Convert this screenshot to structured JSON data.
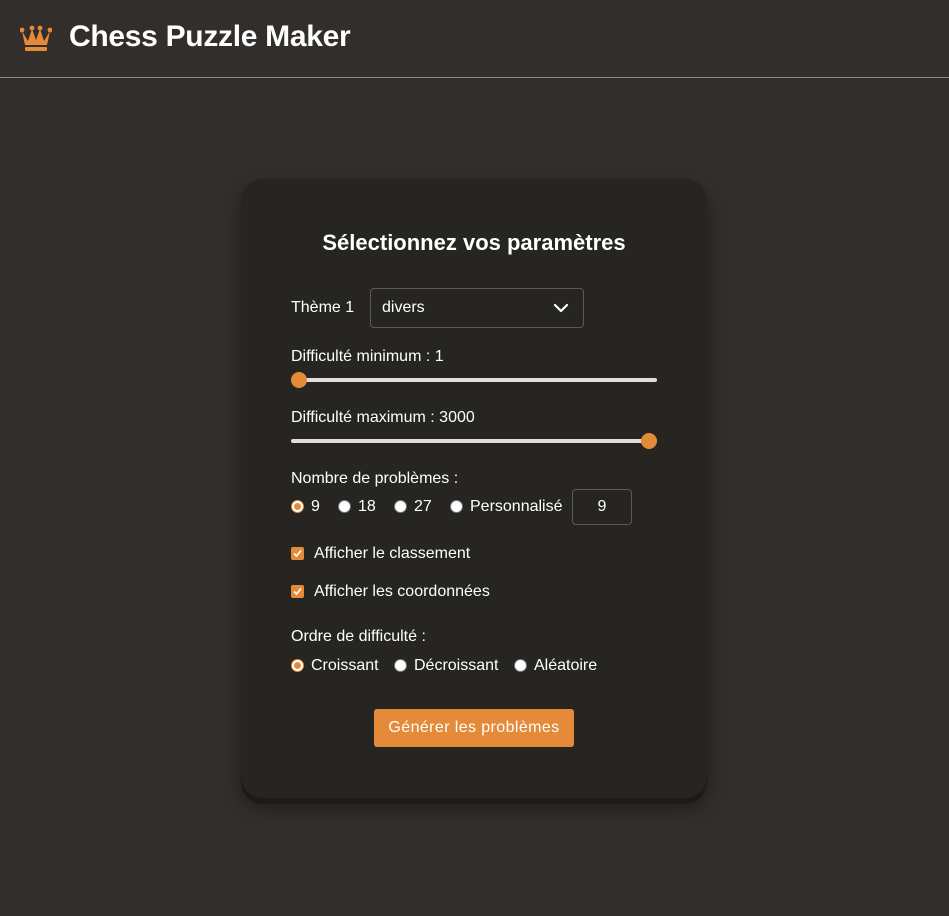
{
  "header": {
    "title": "Chess Puzzle Maker",
    "logo_icon": "crown-icon"
  },
  "form": {
    "title": "Sélectionnez vos paramètres",
    "theme": {
      "label": "Thème 1",
      "value": "divers"
    },
    "difficulty_min": {
      "label": "Difficulté minimum : 1",
      "value": 1,
      "min": 1,
      "max": 3000
    },
    "difficulty_max": {
      "label": "Difficulté maximum : 3000",
      "value": 3000,
      "min": 1,
      "max": 3000
    },
    "puzzle_count": {
      "label": "Nombre de problèmes :",
      "options": [
        "9",
        "18",
        "27",
        "Personnalisé"
      ],
      "selected": "9",
      "custom_value": "9"
    },
    "show_ranking": {
      "label": "Afficher le classement",
      "checked": true
    },
    "show_coordinates": {
      "label": "Afficher les coordonnées",
      "checked": true
    },
    "order": {
      "label": "Ordre de difficulté :",
      "options": [
        "Croissant",
        "Décroissant",
        "Aléatoire"
      ],
      "selected": "Croissant"
    },
    "generate_label": "Générer les problèmes"
  },
  "colors": {
    "background": "#312e2b",
    "card": "#262522",
    "accent": "#e58a39"
  }
}
